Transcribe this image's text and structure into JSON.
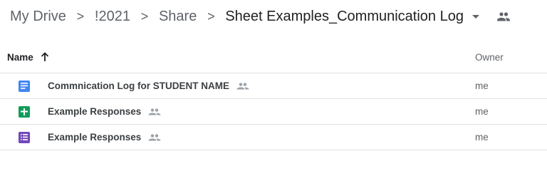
{
  "breadcrumb": {
    "items": [
      "My Drive",
      "!2021",
      "Share",
      "Sheet Examples_Communication Log"
    ],
    "separator": ">"
  },
  "header": {
    "name_label": "Name",
    "owner_label": "Owner"
  },
  "files": [
    {
      "name": "Commnication Log for STUDENT NAME",
      "type": "docs",
      "icon": "google-docs-icon",
      "color": "#4285f4",
      "shared": true,
      "owner": "me"
    },
    {
      "name": "Example Responses",
      "type": "sheets",
      "icon": "google-sheets-icon",
      "color": "#0f9d58",
      "shared": true,
      "owner": "me"
    },
    {
      "name": "Example Responses",
      "type": "forms",
      "icon": "google-forms-icon",
      "color": "#7248b9",
      "shared": true,
      "owner": "me"
    }
  ]
}
